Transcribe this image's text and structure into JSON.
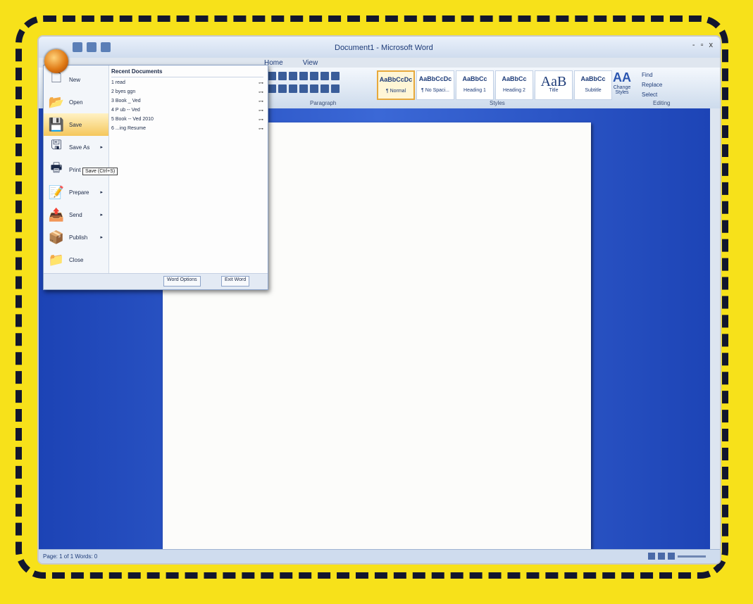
{
  "window": {
    "title": "Document1 - Microsoft Word",
    "controls": [
      "-",
      "▫",
      "x"
    ]
  },
  "tabs": [
    "Home",
    "View"
  ],
  "ribbon": {
    "paragraph_label": "Paragraph",
    "styles_label": "Styles",
    "editing_label": "Editing",
    "styles": [
      {
        "sample": "AaBbCcDc",
        "name": "¶ Normal",
        "active": true
      },
      {
        "sample": "AaBbCcDc",
        "name": "¶ No Spaci...",
        "active": false
      },
      {
        "sample": "AaBbCc",
        "name": "Heading 1",
        "active": false
      },
      {
        "sample": "AaBbCc",
        "name": "Heading 2",
        "active": false
      },
      {
        "sample": "AaB",
        "name": "Title",
        "active": false,
        "big": true
      },
      {
        "sample": "AaBbCc",
        "name": "Subtitle",
        "active": false
      }
    ],
    "change_styles": {
      "icon": "AA",
      "label": "Change Styles"
    },
    "editing": [
      "Find",
      "Replace",
      "Select"
    ]
  },
  "office_menu": {
    "items": [
      {
        "label": "New",
        "icon": "new-document-icon",
        "glyph": "🗋",
        "arrow": false
      },
      {
        "label": "Open",
        "icon": "open-folder-icon",
        "glyph": "📂",
        "arrow": false
      },
      {
        "label": "Save",
        "icon": "save-icon",
        "glyph": "💾",
        "arrow": false,
        "hover": true
      },
      {
        "label": "Save As",
        "icon": "save-as-icon",
        "glyph": "🖫",
        "arrow": true
      },
      {
        "label": "Print",
        "icon": "print-icon",
        "glyph": "🖶",
        "arrow": true
      },
      {
        "label": "Prepare",
        "icon": "prepare-icon",
        "glyph": "📝",
        "arrow": true
      },
      {
        "label": "Send",
        "icon": "send-icon",
        "glyph": "📤",
        "arrow": true
      },
      {
        "label": "Publish",
        "icon": "publish-icon",
        "glyph": "📦",
        "arrow": true
      },
      {
        "label": "Close",
        "icon": "close-folder-icon",
        "glyph": "📁",
        "arrow": false
      }
    ],
    "tooltip": "Save (Ctrl+S)",
    "recent_title": "Recent Documents",
    "recent": [
      "1 read",
      "2 byes ggn",
      "3 Book _ Ved",
      "4 P ub -- Ved",
      "5 Book -- Ved 2010",
      "6 ...ing Resume"
    ],
    "footer": {
      "options": "Word Options",
      "exit": "Exit Word"
    }
  },
  "status": {
    "left": "Page: 1 of 1    Words: 0"
  }
}
